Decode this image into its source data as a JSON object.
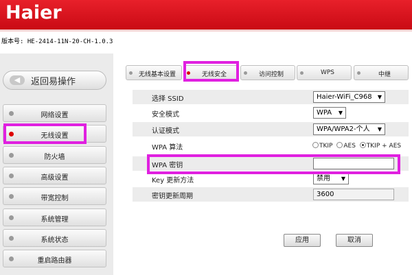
{
  "header": {
    "logo": "Haier"
  },
  "version": "版本号: HE-2414-11N-20-CH-1.0.3",
  "sidebar": {
    "back_label": "返回易操作",
    "back_icon": "back-arrow-icon",
    "items": [
      {
        "label": "网络设置",
        "active": false
      },
      {
        "label": "无线设置",
        "active": true
      },
      {
        "label": "防火墙",
        "active": false
      },
      {
        "label": "高级设置",
        "active": false
      },
      {
        "label": "带宽控制",
        "active": false
      },
      {
        "label": "系统管理",
        "active": false
      },
      {
        "label": "系统状态",
        "active": false
      },
      {
        "label": "重启路由器",
        "active": false
      }
    ]
  },
  "tabs": [
    {
      "label": "无线基本设置",
      "active": false
    },
    {
      "label": "无线安全",
      "active": true
    },
    {
      "label": "访问控制",
      "active": false
    },
    {
      "label": "WPS",
      "active": false
    },
    {
      "label": "中继",
      "active": false
    }
  ],
  "form": {
    "ssid_label": "选择 SSID",
    "ssid_value": "Haier-WiFi_C968",
    "security_mode_label": "安全模式",
    "security_mode_value": "WPA",
    "auth_mode_label": "认证模式",
    "auth_mode_value": "WPA/WPA2-个人",
    "wpa_algo_label": "WPA 算法",
    "wpa_algo_options": [
      "TKIP",
      "AES",
      "TKIP + AES"
    ],
    "wpa_algo_selected": "TKIP + AES",
    "wpa_key_label": "WPA 密钥",
    "wpa_key_value": "",
    "key_update_label": "Key 更新方法",
    "key_update_value": "禁用",
    "key_period_label": "密钥更新周期",
    "key_period_value": "3600"
  },
  "buttons": {
    "apply": "应用",
    "cancel": "取消"
  },
  "colors": {
    "header_red": "#d4121c",
    "highlight": "#e020e0",
    "active_dot": "#dd0000"
  }
}
